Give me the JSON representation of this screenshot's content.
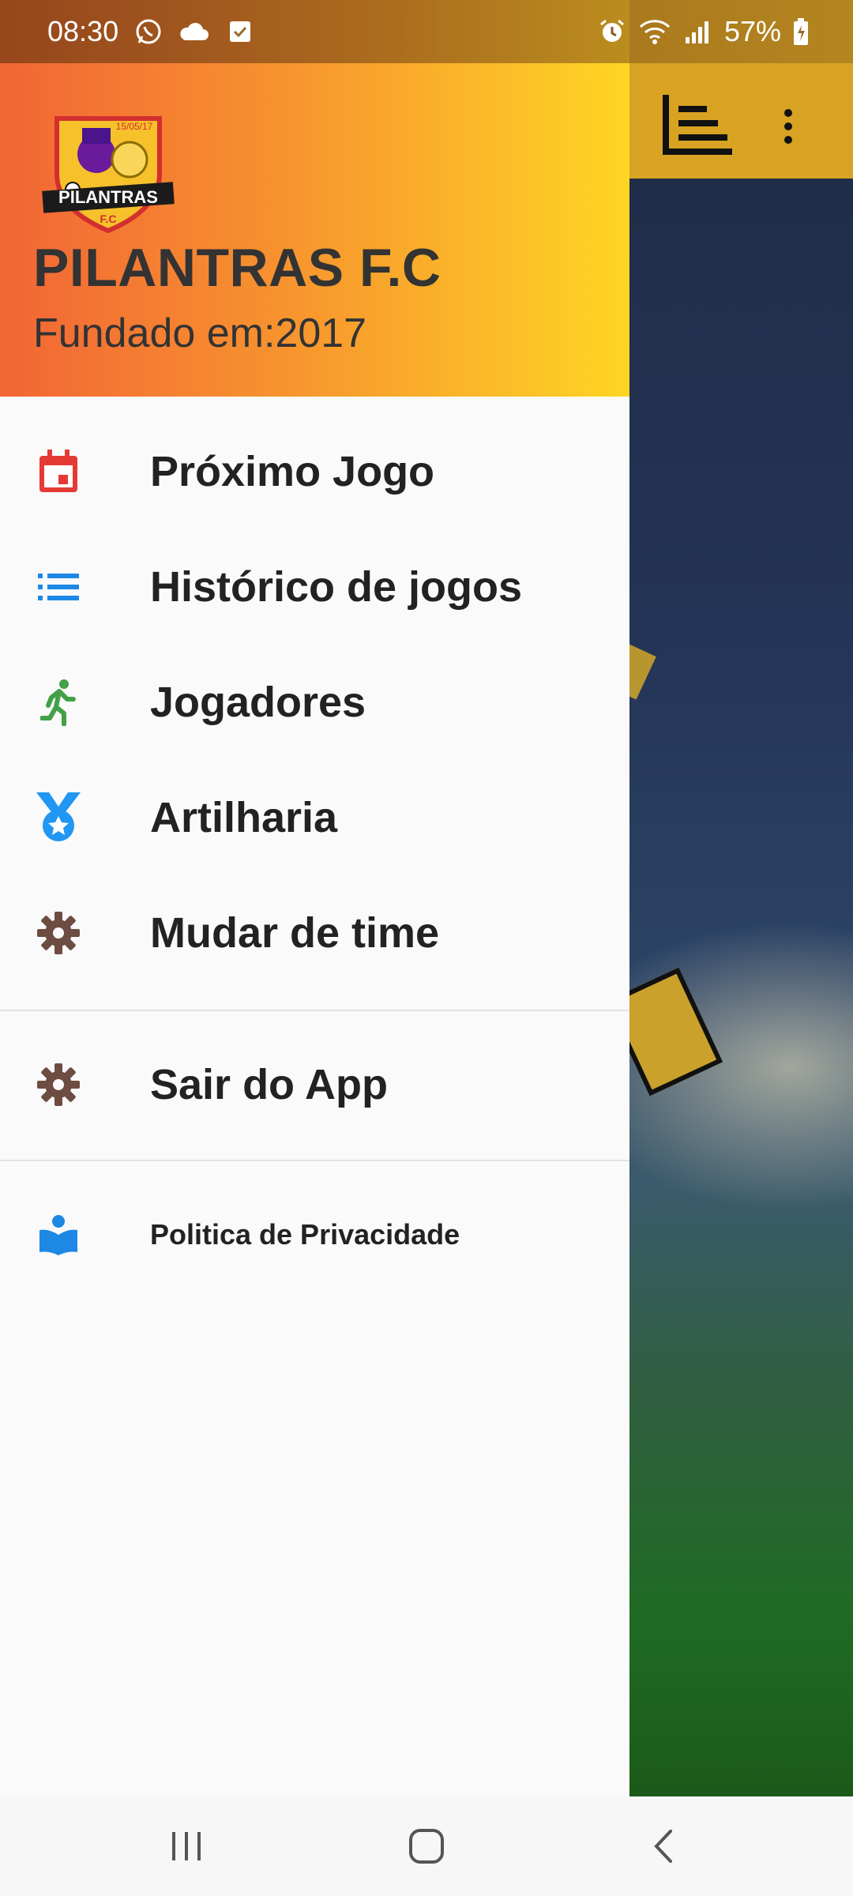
{
  "status_bar": {
    "time": "08:30",
    "battery": "57%",
    "left_icons": [
      "whatsapp-icon",
      "cloud-icon",
      "checkbox-icon"
    ],
    "right_icons": [
      "alarm-icon",
      "wifi-icon",
      "signal-icon",
      "battery-icon"
    ]
  },
  "background_toolbar": {
    "actions": [
      "sort-icon",
      "more-vert-icon"
    ]
  },
  "drawer": {
    "header": {
      "team_name": "PILANTRAS F.C",
      "founded": "Fundado em:2017",
      "logo_text": "PILANTRAS",
      "logo_subtext": "F.C",
      "logo_date": "15/05/17"
    },
    "items": [
      {
        "label": "Próximo Jogo",
        "icon": "calendar-icon",
        "color": "#e53935"
      },
      {
        "label": "Histórico de jogos",
        "icon": "list-icon",
        "color": "#1e88e5"
      },
      {
        "label": "Jogadores",
        "icon": "running-person-icon",
        "color": "#43a047"
      },
      {
        "label": "Artilharia",
        "icon": "medal-icon",
        "color": "#2196f3"
      },
      {
        "label": "Mudar de time",
        "icon": "gear-icon",
        "color": "#6d4c41"
      }
    ],
    "secondary_items": [
      {
        "label": "Sair do App",
        "icon": "gear-icon",
        "color": "#6d4c41"
      }
    ],
    "footer_items": [
      {
        "label": "Politica de Privacidade",
        "icon": "book-reader-icon",
        "color": "#1e88e5"
      }
    ]
  },
  "colors": {
    "header_gradient_start": "#f26535",
    "header_gradient_end": "#ffd524",
    "drawer_bg": "#fafafa",
    "toolbar_bg": "#d8a322"
  },
  "nav_bar": {
    "buttons": [
      "recents-icon",
      "home-icon",
      "back-icon"
    ]
  }
}
